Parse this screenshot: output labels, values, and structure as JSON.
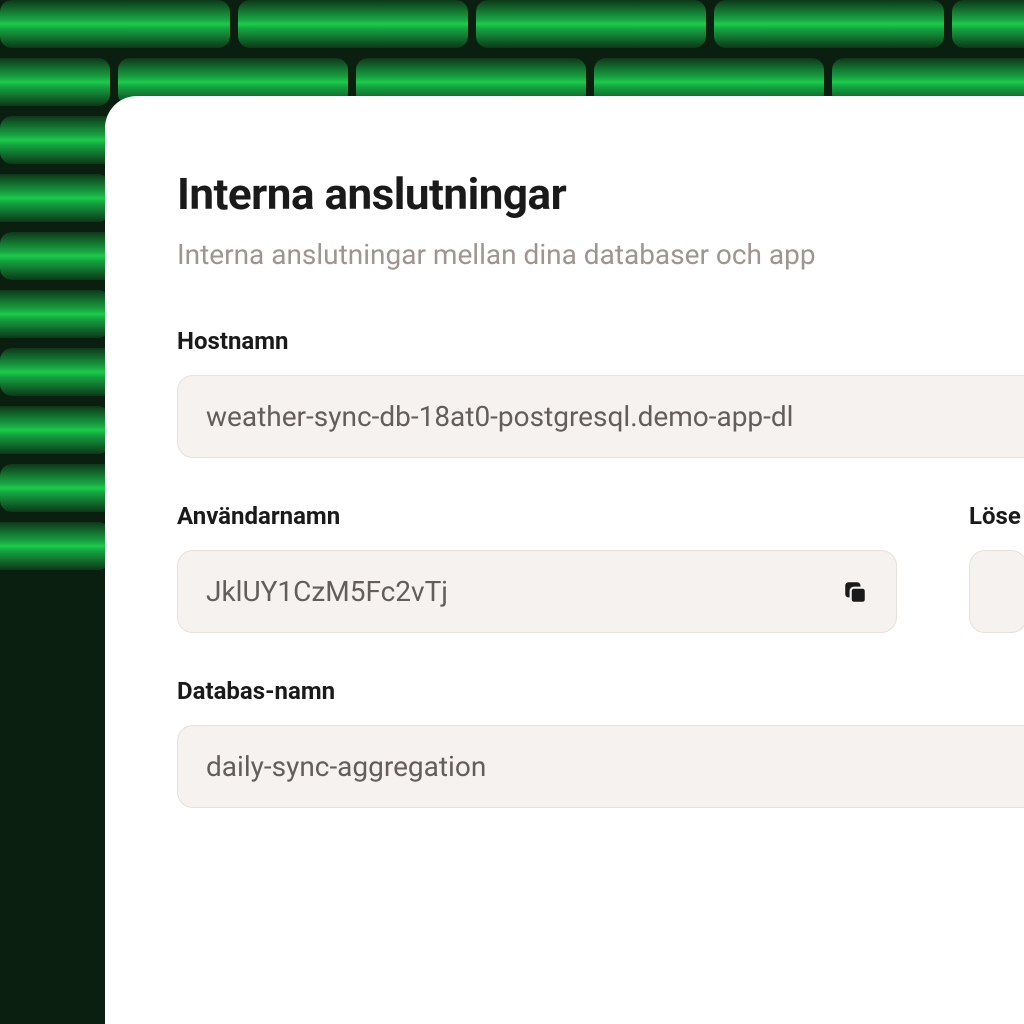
{
  "header": {
    "title": "Interna anslutningar",
    "subtitle": "Interna anslutningar mellan dina databaser och app"
  },
  "fields": {
    "hostname": {
      "label": "Hostnamn",
      "value": "weather-sync-db-18at0-postgresql.demo-app-dl"
    },
    "username": {
      "label": "Användarnamn",
      "value": "JklUY1CzM5Fc2vTj"
    },
    "password": {
      "label": "Löse",
      "value": "••"
    },
    "database_name": {
      "label": "Databas-namn",
      "value": "daily-sync-aggregation"
    }
  }
}
